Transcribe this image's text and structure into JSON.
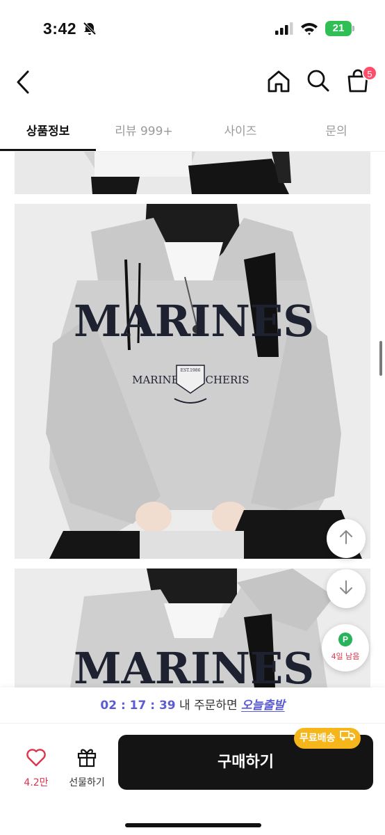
{
  "status_bar": {
    "time": "3:42",
    "battery": "21"
  },
  "header": {
    "cart_count": "5"
  },
  "tabs": [
    {
      "label": "상품정보",
      "active": true
    },
    {
      "label": "리뷰 999+",
      "active": false
    },
    {
      "label": "사이즈",
      "active": false
    },
    {
      "label": "문의",
      "active": false
    }
  ],
  "product_images": {
    "print_main": "MARINES",
    "print_sub_left": "MARINES",
    "print_sub_right": "CHERIS",
    "print_badge": "EST.1986"
  },
  "floating": {
    "points_icon": "P",
    "points_label": "4일 남음"
  },
  "timer_bar": {
    "countdown": "02 : 17 : 39",
    "middle": "내 주문하면",
    "emphasis": "오늘출발"
  },
  "bottom_bar": {
    "like_count": "4.2만",
    "gift_label": "선물하기",
    "buy_label": "구매하기",
    "free_shipping_label": "무료배송"
  },
  "colors": {
    "accent_pink": "#e0334a",
    "timer_purple": "#5b5bd6",
    "free_shipping": "#f6b51a",
    "points_green": "#27b35a",
    "buy_button": "#141414"
  }
}
